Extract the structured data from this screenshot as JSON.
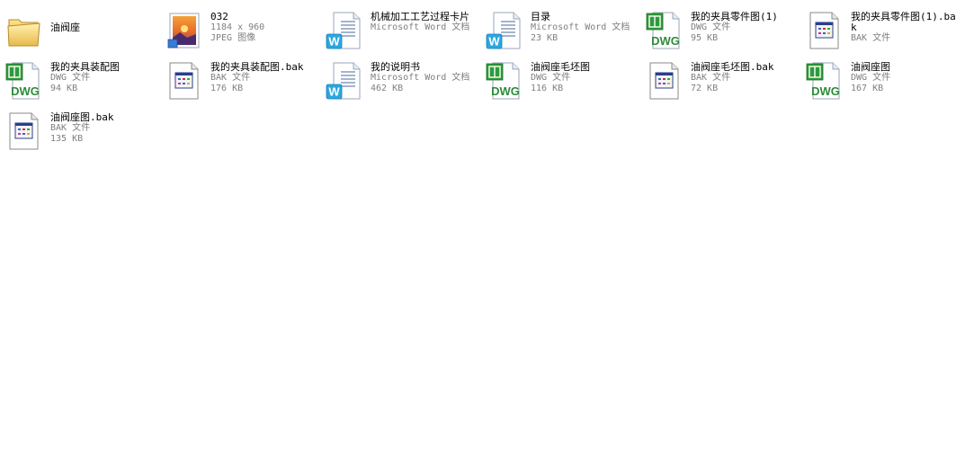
{
  "view": {
    "name": "file-view"
  },
  "files": [
    {
      "key": "folder-youfazuo",
      "icon": "folder-icon",
      "name": "油阀座",
      "line1": "",
      "line2": "",
      "col": 0,
      "row": 0
    },
    {
      "key": "image-032",
      "icon": "jpeg-icon",
      "name": "032",
      "line1": "1184 x 960",
      "line2": "JPEG 图像",
      "col": 1,
      "row": 0
    },
    {
      "key": "doc-jixie",
      "icon": "word-icon",
      "name": "机械加工工艺过程卡片",
      "line1": "Microsoft Word 文档",
      "line2": "",
      "col": 2,
      "row": 0
    },
    {
      "key": "doc-mulu",
      "icon": "word-icon",
      "name": "目录",
      "line1": "Microsoft Word 文档",
      "line2": "23 KB",
      "col": 3,
      "row": 0
    },
    {
      "key": "dwg-lingjian-1",
      "icon": "dwg-icon",
      "name": "我的夹具零件图(1)",
      "line1": "DWG 文件",
      "line2": "95 KB",
      "col": 4,
      "row": 0
    },
    {
      "key": "bak-lingjian-1",
      "icon": "bak-icon",
      "name": "我的夹具零件图(1).bak",
      "line1": "BAK 文件",
      "line2": "",
      "col": 5,
      "row": 0
    },
    {
      "key": "dwg-zhuangpei",
      "icon": "dwg-icon",
      "name": "我的夹具装配图",
      "line1": "DWG 文件",
      "line2": "94 KB",
      "col": 0,
      "row": 1
    },
    {
      "key": "bak-zhuangpei",
      "icon": "bak-icon",
      "name": "我的夹具装配图.bak",
      "line1": "BAK 文件",
      "line2": "176 KB",
      "col": 1,
      "row": 1
    },
    {
      "key": "doc-shuoming",
      "icon": "word-icon",
      "name": "我的说明书",
      "line1": "Microsoft Word 文档",
      "line2": "462 KB",
      "col": 2,
      "row": 1
    },
    {
      "key": "dwg-maopi",
      "icon": "dwg-icon",
      "name": "油阀座毛坯图",
      "line1": "DWG 文件",
      "line2": "116 KB",
      "col": 3,
      "row": 1
    },
    {
      "key": "bak-maopi",
      "icon": "bak-icon",
      "name": "油阀座毛坯图.bak",
      "line1": "BAK 文件",
      "line2": "72 KB",
      "col": 4,
      "row": 1
    },
    {
      "key": "dwg-youfazuotu",
      "icon": "dwg-icon",
      "name": "油阀座图",
      "line1": "DWG 文件",
      "line2": "167 KB",
      "col": 5,
      "row": 1
    },
    {
      "key": "bak-youfazuotu",
      "icon": "bak-icon",
      "name": "油阀座图.bak",
      "line1": "BAK 文件",
      "line2": "135 KB",
      "col": 0,
      "row": 2
    }
  ]
}
